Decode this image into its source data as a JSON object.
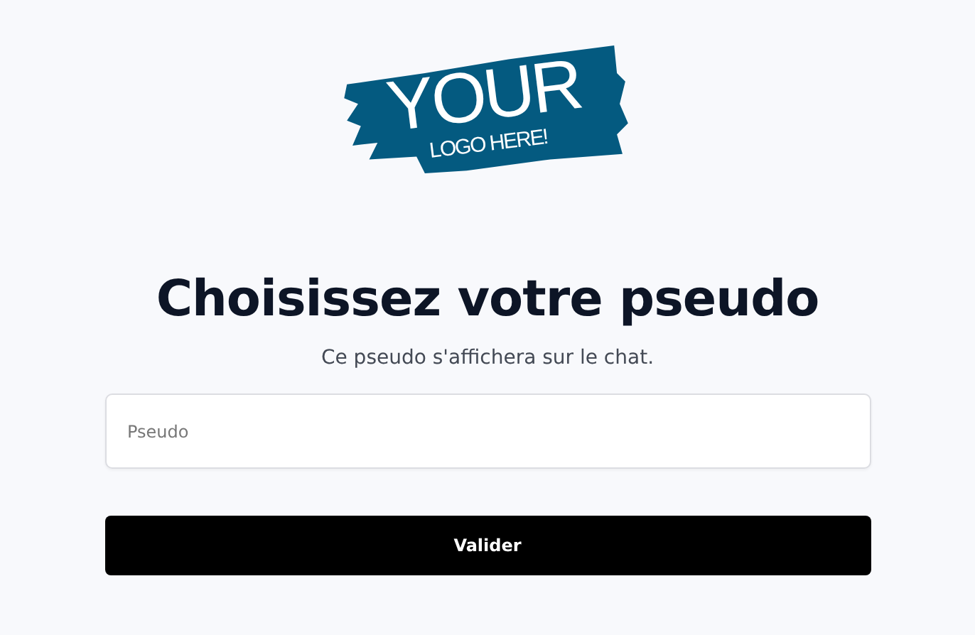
{
  "logo": {
    "title": "YOUR",
    "subtitle": "LOGO HERE!"
  },
  "heading": "Choisissez votre pseudo",
  "description": "Ce pseudo s'affichera sur le chat.",
  "field": {
    "placeholder": "Pseudo"
  },
  "button": {
    "label": "Valider"
  }
}
